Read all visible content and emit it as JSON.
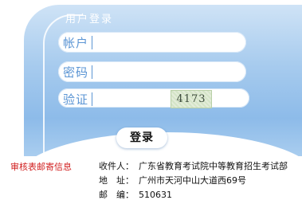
{
  "panel": {
    "title": "用户登录"
  },
  "form": {
    "username_label": "帐户",
    "password_label": "密码",
    "captcha_label": "验证",
    "captcha_text": "4173",
    "login_label": "登录"
  },
  "footer": {
    "audit_link": "审核表邮寄信息",
    "recipient_label": "收件人：",
    "recipient_value": "广东省教育考试院中等教育招生考试部",
    "address_label": "地　址：",
    "address_value": "广州市天河中山大道西69号",
    "postcode_label": "邮　编：",
    "postcode_value": "510631"
  },
  "colors": {
    "panel_blue": "#8dbbe9",
    "label_blue": "#5b95d4",
    "link_red": "#d12020"
  }
}
